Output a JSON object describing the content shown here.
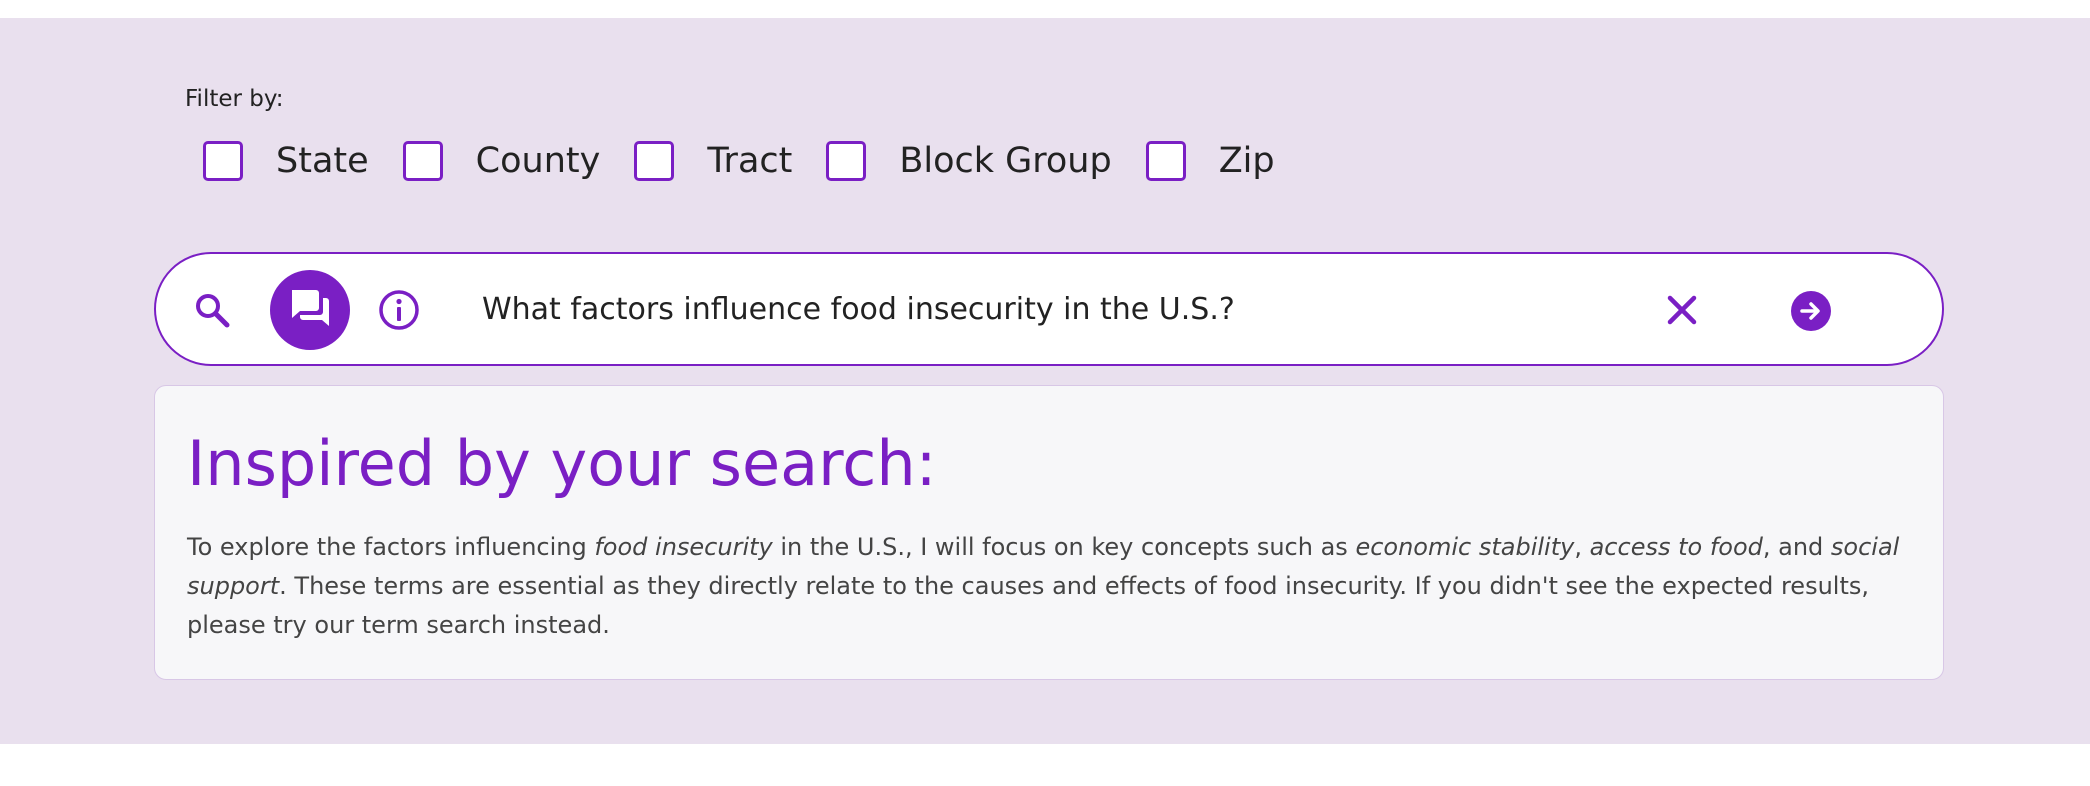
{
  "filters": {
    "label": "Filter by:",
    "options": [
      {
        "label": "State",
        "checked": false
      },
      {
        "label": "County",
        "checked": false
      },
      {
        "label": "Tract",
        "checked": false
      },
      {
        "label": "Block Group",
        "checked": false
      },
      {
        "label": "Zip",
        "checked": false
      }
    ]
  },
  "search": {
    "query": "What factors influence food insecurity in the U.S.?",
    "icons": {
      "search": "search-icon",
      "chat": "chat-bubbles-icon",
      "info": "info-icon",
      "clear": "close-icon",
      "submit": "arrow-right-icon"
    }
  },
  "result": {
    "title": "Inspired by your search:",
    "body": {
      "p1": "To explore the factors influencing ",
      "em1": "food insecurity",
      "p2": " in the U.S., I will focus on key concepts such as ",
      "em2": "economic stability",
      "p3": ", ",
      "em3": "access to food",
      "p4": ", and ",
      "em4": "social support",
      "p5": ". These terms are essential as they directly relate to the causes and effects of food insecurity. If you didn't see the expected results, please try our term search instead."
    }
  },
  "colors": {
    "accent": "#7a1fc4",
    "band_background": "#e9e0ee",
    "card_background": "#f7f7f9"
  }
}
